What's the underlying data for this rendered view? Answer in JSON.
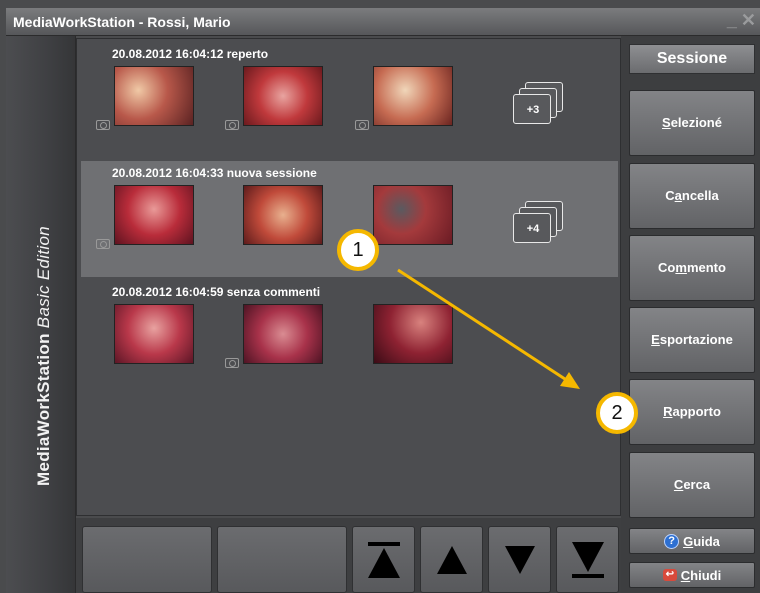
{
  "window": {
    "title": "MediaWorkStation - Rossi, Mario"
  },
  "brand": {
    "name": "MediaWorkStation",
    "edition": "Basic Edition"
  },
  "sessions": [
    {
      "title": "20.08.2012 16:04:12 reperto",
      "more": "+3"
    },
    {
      "title": "20.08.2012 16:04:33 nuova sessione",
      "more": "+4"
    },
    {
      "title": "20.08.2012 16:04:59 senza commenti"
    }
  ],
  "sidebar": {
    "header": "Sessione",
    "buttons": [
      {
        "key": "S",
        "rest": "elezioné"
      },
      {
        "pre": "C",
        "key": "a",
        "rest": "ncella"
      },
      {
        "pre": "Co",
        "key": "m",
        "rest": "mento"
      },
      {
        "key": "E",
        "rest": "sportazione"
      },
      {
        "key": "R",
        "rest": "apporto"
      },
      {
        "key": "C",
        "rest": "erca"
      }
    ],
    "help": {
      "key": "G",
      "rest": "uida"
    },
    "exit": {
      "key": "C",
      "rest": "hiudi"
    }
  },
  "callouts": {
    "one": "1",
    "two": "2"
  },
  "colors": {
    "accent": "#f5b800",
    "selected_row": "#6f7073",
    "background": "#4a4b4d"
  }
}
